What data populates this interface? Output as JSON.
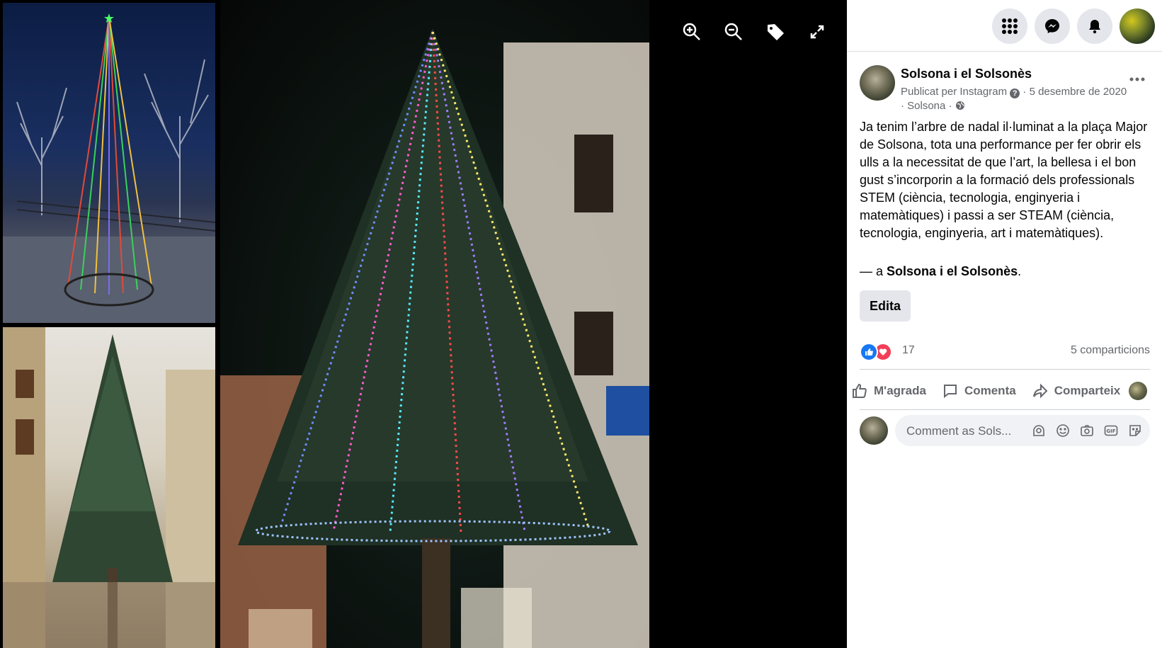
{
  "viewer": {
    "photos": [
      "christmas-tree-light-cone",
      "fir-tree-town-square",
      "illuminated-christmas-tree-night"
    ],
    "tools": [
      "zoom-in-icon",
      "zoom-out-icon",
      "tag-icon",
      "fullscreen-icon"
    ]
  },
  "topnav": {
    "icons": [
      "menu-grid-icon",
      "messenger-icon",
      "notifications-icon",
      "profile-avatar"
    ]
  },
  "post": {
    "page_name": "Solsona i el Solsonès",
    "meta_published": "Publicat per Instagram",
    "meta_date": "· 5 desembre de 2020 · Solsona ·",
    "text": "Ja tenim l’arbre de nadal il·luminat a la plaça Major de Solsona, tota una performance per fer obrir els ulls a la necessitat de que l’art, la bellesa i el bon gust s’incorporin a la formació dels professionals STEM (ciència, tecnologia, enginyeria i matemàtiques) i passi a ser STEAM (ciència, tecnologia, enginyeria, art i matemàtiques).",
    "tag_prefix": "— a",
    "tag_place": "Solsona i el Solsonès",
    "tag_suffix": ".",
    "edit_label": "Edita",
    "reaction_count": "17",
    "shares": "5 comparticions",
    "actions": {
      "like": "M'agrada",
      "comment": "Comenta",
      "share": "Comparteix"
    },
    "comment_placeholder": "Comment as Sols..."
  },
  "colors": {
    "accent": "#1877f2",
    "love": "#f33e58",
    "muted": "#65676b"
  }
}
